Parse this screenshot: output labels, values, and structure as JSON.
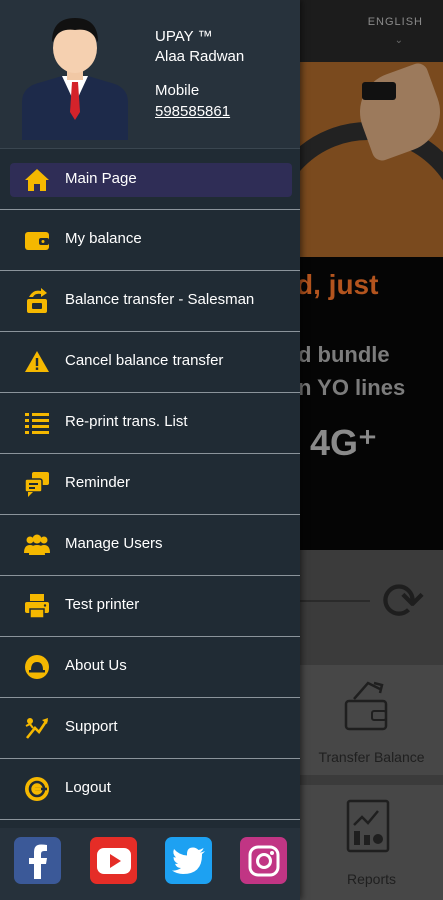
{
  "background": {
    "language": "ENGLISH",
    "promo": {
      "line1": "d, just",
      "line2": "d bundle",
      "line3": "n YO lines",
      "line4": "4G⁺"
    },
    "tiles": [
      {
        "label": "Transfer Balance",
        "icon": "wallet-transfer-icon"
      },
      {
        "label": "Reports",
        "icon": "report-icon"
      }
    ]
  },
  "profile": {
    "app_name": "UPAY ™",
    "user_name": "Alaa Radwan",
    "mobile_label": "Mobile",
    "mobile_number": "598585861"
  },
  "menu": [
    {
      "label": "Main Page",
      "icon": "home-icon",
      "active": true
    },
    {
      "label": "My balance",
      "icon": "wallet-icon"
    },
    {
      "label": "Balance transfer - Salesman",
      "icon": "transfer-icon"
    },
    {
      "label": "Cancel balance transfer",
      "icon": "warning-icon"
    },
    {
      "label": "Re-print trans. List",
      "icon": "list-icon"
    },
    {
      "label": "Reminder",
      "icon": "chat-icon"
    },
    {
      "label": "Manage Users",
      "icon": "users-icon"
    },
    {
      "label": "Test printer",
      "icon": "printer-icon"
    },
    {
      "label": "About Us",
      "icon": "info-icon"
    },
    {
      "label": "Support",
      "icon": "support-icon"
    },
    {
      "label": "Logout",
      "icon": "logout-icon"
    }
  ],
  "social": [
    {
      "name": "facebook",
      "color": "#3b5998"
    },
    {
      "name": "youtube",
      "color": "#e52d27"
    },
    {
      "name": "twitter",
      "color": "#1da1f2"
    },
    {
      "name": "instagram",
      "color": "#c13584"
    }
  ],
  "colors": {
    "accent": "#f5b800",
    "drawer_bg": "#202b34",
    "active_bg": "#2f2d56"
  }
}
